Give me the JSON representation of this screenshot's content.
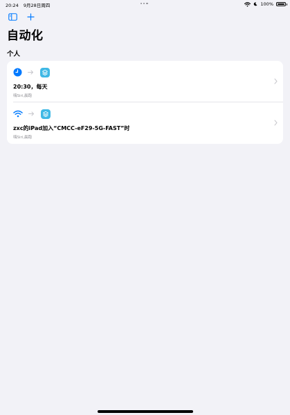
{
  "status_bar": {
    "time": "20:24",
    "date": "9月28日周四",
    "battery": "100%"
  },
  "icons": {
    "sidebar": "sidebar-icon",
    "add": "plus-icon",
    "clock": "clock-icon",
    "wifi": "wifi-icon",
    "arrow": "arrow-right-icon",
    "shortcuts_app": "shortcuts-app-icon",
    "chevron": "chevron-right-icon",
    "moon": "moon-icon",
    "battery": "battery-icon"
  },
  "colors": {
    "accent": "#007aff",
    "background": "#f2f2f7",
    "app_tile": "#3fb8e5",
    "secondary_text": "#8e8e93"
  },
  "page": {
    "title": "自动化",
    "section": "个人"
  },
  "automations": [
    {
      "trigger_icon": "clock-icon",
      "title": "20:30，每天",
      "subtitle": "嗨Siri,晨跑"
    },
    {
      "trigger_icon": "wifi-icon",
      "title": "zxc的iPad加入“CMCC-eF29-5G-FAST”时",
      "subtitle": "嗨Siri,晨跑"
    }
  ]
}
